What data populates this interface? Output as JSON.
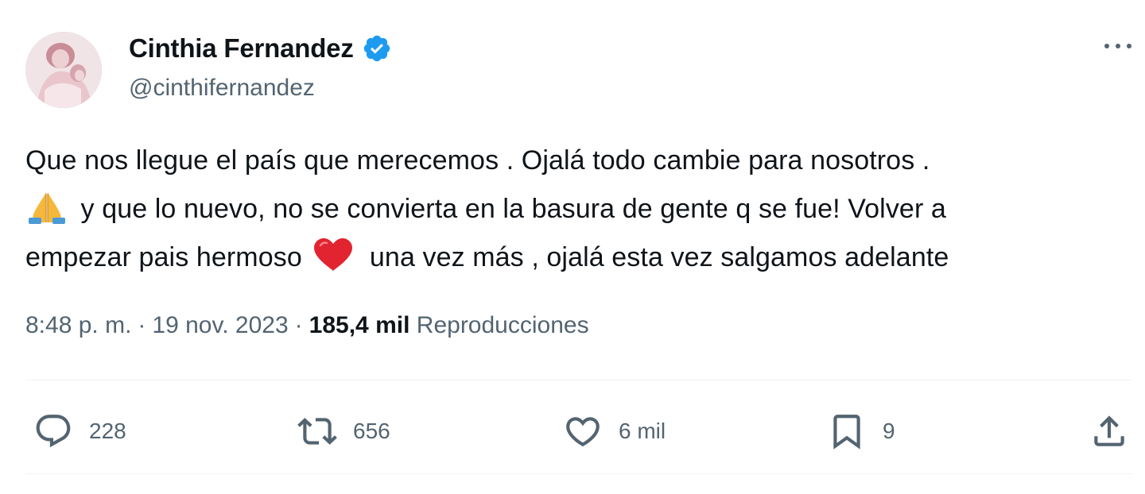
{
  "author": {
    "display_name": "Cinthia Fernandez",
    "handle": "@cinthifernandez",
    "verified": true
  },
  "tweet": {
    "lines": [
      "Que nos llegue el país que merecemos . Ojalá todo cambie para nosotros .",
      " y que lo nuevo, no se convierta en la basura de gente q se fue! Volver a",
      "empezar pais hermoso ",
      " una vez más , ojalá esta vez salgamos adelante"
    ],
    "emojis": {
      "line2_start": "folded-hands-emoji",
      "line3_mid": "red-heart-emoji"
    }
  },
  "meta": {
    "time": "8:48 p. m.",
    "separator": "·",
    "date": "19 nov. 2023",
    "views_count": "185,4 mil",
    "views_label": "Reproducciones"
  },
  "actions": {
    "reply_count": "228",
    "retweet_count": "656",
    "like_count": "6 mil",
    "bookmark_count": "9"
  },
  "icons": {
    "more": "more-icon",
    "reply": "reply-icon",
    "retweet": "retweet-icon",
    "like": "heart-icon",
    "bookmark": "bookmark-icon",
    "share": "share-icon",
    "verified": "verified-badge-icon"
  },
  "colors": {
    "text_primary": "#0f1419",
    "text_secondary": "#536471",
    "verified_blue": "#1d9bf0",
    "divider": "#eff3f4"
  }
}
